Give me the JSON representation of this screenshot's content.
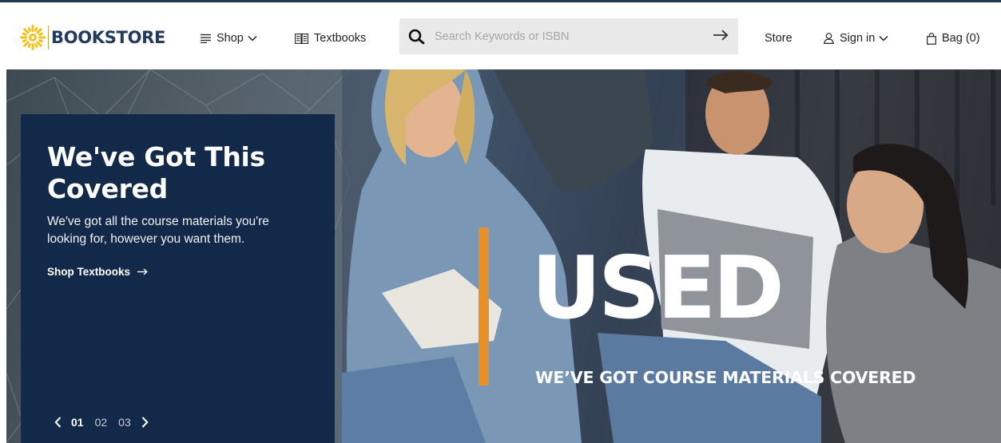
{
  "brand": {
    "name": "BOOKSTORE",
    "logo_icon": "sunburst-logo-icon",
    "accent": "#f3c21a",
    "text_color": "#223a5e"
  },
  "nav": {
    "shop": {
      "label": "Shop",
      "icon": "menu-lines-icon",
      "caret": "chevron-down-icon"
    },
    "textbooks": {
      "label": "Textbooks",
      "icon": "open-book-icon"
    },
    "store": {
      "label": "Store"
    },
    "sign_in": {
      "label": "Sign in",
      "icon": "user-icon",
      "caret": "chevron-down-icon"
    },
    "bag": {
      "label": "Bag (0)",
      "icon": "shopping-bag-icon"
    }
  },
  "search": {
    "placeholder": "Search Keywords or ISBN",
    "value": "",
    "icon": "search-icon",
    "submit_icon": "arrow-right-icon"
  },
  "hero": {
    "headline": "We've Got This Covered",
    "description": "We've got all the course materials you're looking for, however you want them.",
    "cta": "Shop Textbooks",
    "cta_icon": "arrow-right-icon",
    "panel_color": "#13294a",
    "accent_color": "#e6902c",
    "banner_word": "USED",
    "banner_tagline": "WE’VE GOT COURSE MATERIALS COVERED",
    "pager": {
      "prev_icon": "chevron-left-icon",
      "next_icon": "chevron-right-icon",
      "pages": [
        "01",
        "02",
        "03"
      ],
      "active": "01"
    }
  }
}
